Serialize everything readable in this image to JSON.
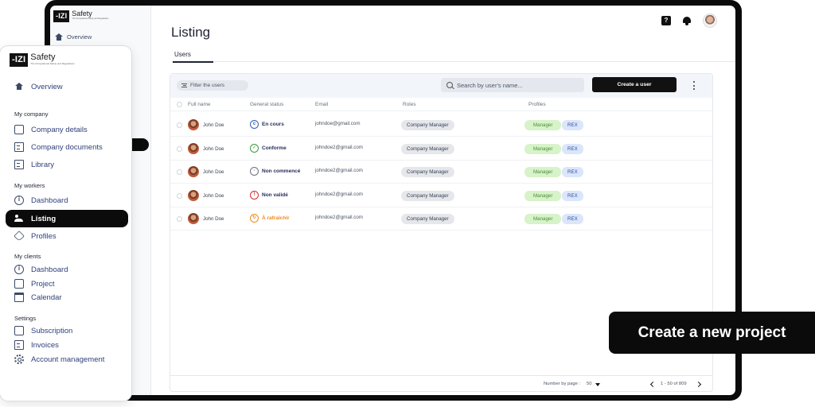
{
  "brand": {
    "logo_mark": "-IZI",
    "logo_text": "Safety",
    "tagline": "The Occupational Safety and Regulations"
  },
  "inner_sidebar": {
    "overview": "Overview"
  },
  "header": {
    "page_title": "Listing",
    "tab_users": "Users",
    "help_glyph": "?"
  },
  "toolbar": {
    "filter_placeholder": "Filter the users",
    "search_placeholder": "Search by user's name...",
    "create_button": "Create a user"
  },
  "table": {
    "columns": [
      "Full name",
      "General status",
      "Email",
      "Roles",
      "Profiles"
    ],
    "rows": [
      {
        "name": "John Doe",
        "status": "En cours",
        "status_glyph": "c",
        "status_color": "#2f5fbf",
        "email": "johndoe@gmail.com",
        "role": "Company Manager",
        "profile_1": "Manager",
        "profile_2": "REX"
      },
      {
        "name": "John Doe",
        "status": "Conforme",
        "status_glyph": "✓",
        "status_color": "#3a9b3a",
        "email": "johndoe2@gmail.com",
        "role": "Company Manager",
        "profile_1": "Manager",
        "profile_2": "REX"
      },
      {
        "name": "John Doe",
        "status": "Non commencé",
        "status_glyph": "·",
        "status_color": "#6b7280",
        "email": "johndoe2@gmail.com",
        "role": "Company Manager",
        "profile_1": "Manager",
        "profile_2": "REX"
      },
      {
        "name": "John Doe",
        "status": "Non validé",
        "status_glyph": "!",
        "status_color": "#d32f2f",
        "email": "johndoe2@gmail.com",
        "role": "Company Manager",
        "profile_1": "Manager",
        "profile_2": "REX"
      },
      {
        "name": "John Doe",
        "status": "À rafraîchir",
        "status_glyph": "↻",
        "status_color": "#f08a1c",
        "email": "johndoe2@gmail.com",
        "role": "Company Manager",
        "profile_1": "Manager",
        "profile_2": "REX"
      }
    ]
  },
  "footer": {
    "rows_per_page_label": "Number by page :",
    "rows_per_page_value": "50",
    "range": "1 - 50 of 809"
  },
  "sidebar": {
    "overview": "Overview",
    "section_company": "My company",
    "company_details": "Company details",
    "company_documents": "Company documents",
    "library": "Library",
    "section_workers": "My workers",
    "dashboard": "Dashboard",
    "listing": "Listing",
    "profiles": "Profiles",
    "section_clients": "My clients",
    "clients_dashboard": "Dashboard",
    "project": "Project",
    "calendar": "Calendar",
    "section_settings": "Settings",
    "subscription": "Subscription",
    "invoices": "Invoices",
    "account_management": "Account management"
  },
  "callout": {
    "text": "Create a new project"
  }
}
